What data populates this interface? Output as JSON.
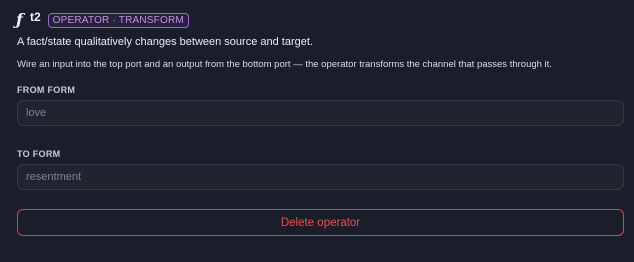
{
  "header": {
    "icon": "function-icon",
    "icon_glyph": "ƒ",
    "operator_id": "t2",
    "badge": "OPERATOR · TRANSFORM"
  },
  "description": "A fact/state qualitatively changes between source and target.",
  "hint": "Wire an input into the top port and an output from the bottom port — the operator transforms the channel that passes through it.",
  "from_form": {
    "label": "FROM FORM",
    "placeholder": "love",
    "value": ""
  },
  "to_form": {
    "label": "TO FORM",
    "placeholder": "resentment",
    "value": ""
  },
  "actions": {
    "delete_label": "Delete operator"
  },
  "colors": {
    "background": "#1a1e2b",
    "badge_accent": "#a463d6",
    "danger": "#f24c4a"
  }
}
